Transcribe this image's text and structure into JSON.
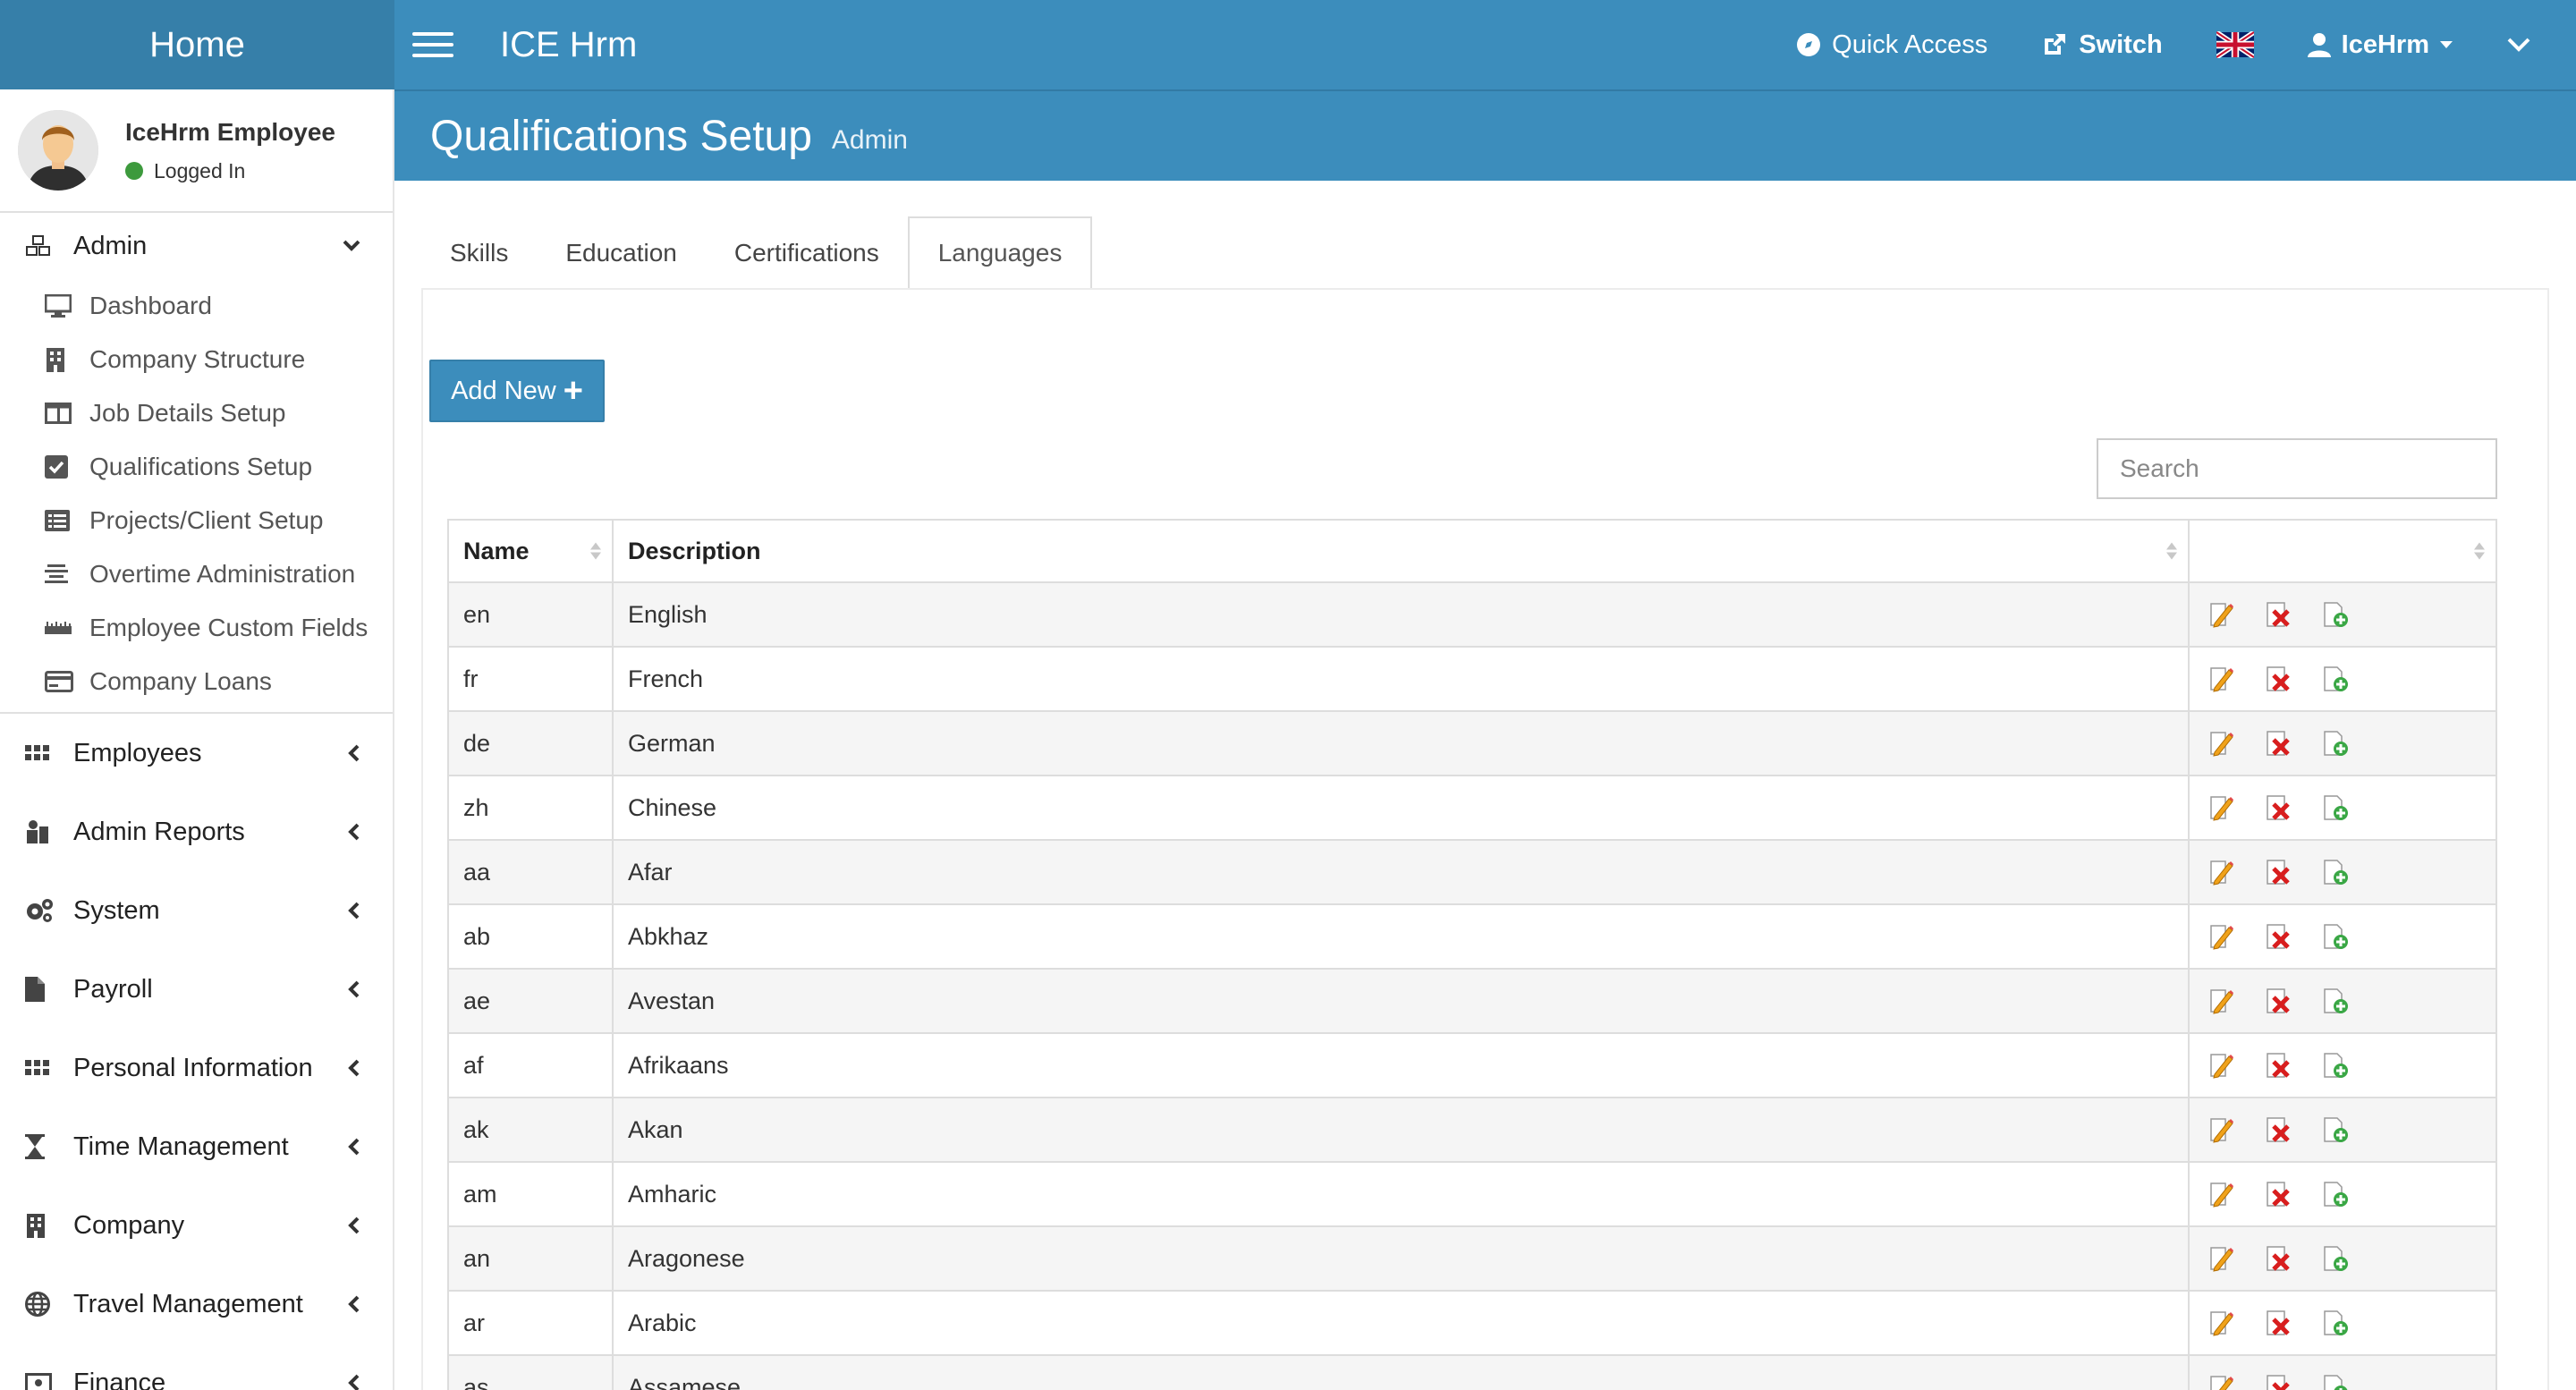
{
  "header": {
    "brand": "Home",
    "app_title": "ICE Hrm",
    "quick_access": "Quick Access",
    "switch": "Switch",
    "user_menu": "IceHrm"
  },
  "user_panel": {
    "name": "IceHrm Employee",
    "status": "Logged In"
  },
  "sidebar": {
    "admin": {
      "label": "Admin",
      "items": [
        {
          "label": "Dashboard",
          "icon": "desktop-icon"
        },
        {
          "label": "Company Structure",
          "icon": "building-icon"
        },
        {
          "label": "Job Details Setup",
          "icon": "columns-icon"
        },
        {
          "label": "Qualifications Setup",
          "icon": "check-square-icon"
        },
        {
          "label": "Projects/Client Setup",
          "icon": "list-alt-icon"
        },
        {
          "label": "Overtime Administration",
          "icon": "align-center-icon"
        },
        {
          "label": "Employee Custom Fields",
          "icon": "ruler-icon"
        },
        {
          "label": "Company Loans",
          "icon": "credit-card-icon"
        }
      ]
    },
    "sections": [
      {
        "label": "Employees",
        "icon": "grid-icon"
      },
      {
        "label": "Admin Reports",
        "icon": "reports-icon"
      },
      {
        "label": "System",
        "icon": "cogs-icon"
      },
      {
        "label": "Payroll",
        "icon": "file-icon"
      },
      {
        "label": "Personal Information",
        "icon": "grid-icon"
      },
      {
        "label": "Time Management",
        "icon": "hourglass-icon"
      },
      {
        "label": "Company",
        "icon": "building-icon"
      },
      {
        "label": "Travel Management",
        "icon": "globe-icon"
      },
      {
        "label": "Finance",
        "icon": "money-icon"
      }
    ]
  },
  "page": {
    "title": "Qualifications Setup",
    "subtitle": "Admin"
  },
  "tabs": [
    {
      "label": "Skills",
      "active": false
    },
    {
      "label": "Education",
      "active": false
    },
    {
      "label": "Certifications",
      "active": false
    },
    {
      "label": "Languages",
      "active": true
    }
  ],
  "toolbar": {
    "add_new": "Add New",
    "search_placeholder": "Search"
  },
  "table": {
    "columns": [
      "Name",
      "Description",
      ""
    ],
    "rows": [
      {
        "name": "en",
        "description": "English"
      },
      {
        "name": "fr",
        "description": "French"
      },
      {
        "name": "de",
        "description": "German"
      },
      {
        "name": "zh",
        "description": "Chinese"
      },
      {
        "name": "aa",
        "description": "Afar"
      },
      {
        "name": "ab",
        "description": "Abkhaz"
      },
      {
        "name": "ae",
        "description": "Avestan"
      },
      {
        "name": "af",
        "description": "Afrikaans"
      },
      {
        "name": "ak",
        "description": "Akan"
      },
      {
        "name": "am",
        "description": "Amharic"
      },
      {
        "name": "an",
        "description": "Aragonese"
      },
      {
        "name": "ar",
        "description": "Arabic"
      },
      {
        "name": "as",
        "description": "Assamese"
      }
    ]
  },
  "colors": {
    "topbar": "#3c8dbc",
    "brand": "#367fa9",
    "status_online": "#3d9a3d"
  }
}
